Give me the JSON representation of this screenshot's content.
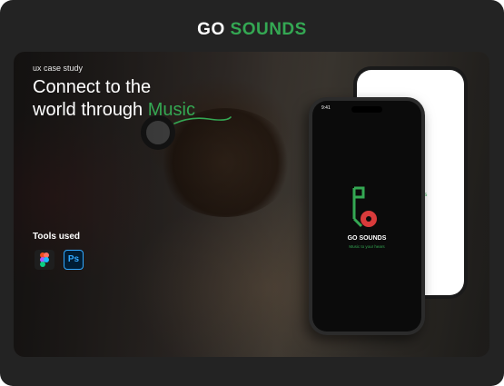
{
  "brand": {
    "prefix": "GO ",
    "accent": "SOUNDS",
    "accent_color": "#34a853"
  },
  "hero": {
    "eyebrow": "ux case study",
    "headline_line1": "Connect to the",
    "headline_line2_prefix": "world through ",
    "headline_highlight": "Music",
    "tools_label": "Tools used",
    "tools": [
      {
        "name": "Figma",
        "icon": "figma-icon"
      },
      {
        "name": "Photoshop",
        "icon": "photoshop-icon",
        "glyph": "Ps"
      }
    ]
  },
  "phone": {
    "status_time": "9:41",
    "app_name_prefix": "GO ",
    "app_name_accent": "SOUNDS",
    "tagline": "Music to your hears",
    "logo_icon": "music-note-record-icon"
  }
}
